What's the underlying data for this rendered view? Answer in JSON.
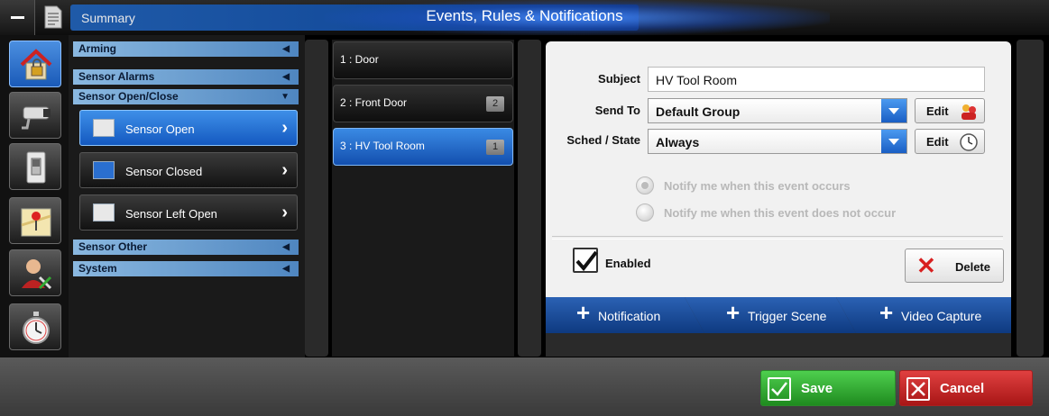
{
  "header": {
    "title": "Events, Rules & Notifications",
    "summary_tab": "Summary"
  },
  "rail": {
    "items": [
      {
        "icon": "house-lock-icon",
        "active": true
      },
      {
        "icon": "security-camera-icon",
        "active": false
      },
      {
        "icon": "light-switch-icon",
        "active": false
      },
      {
        "icon": "map-pin-icon",
        "active": false
      },
      {
        "icon": "user-tools-icon",
        "active": false
      },
      {
        "icon": "stopwatch-icon",
        "active": false
      }
    ]
  },
  "categories": {
    "arming": "Arming",
    "sensor_alarms": "Sensor Alarms",
    "sensor_open_close": "Sensor Open/Close",
    "sensor_other": "Sensor Other",
    "system": "System",
    "subitems": [
      {
        "label": "Sensor Open",
        "active": true
      },
      {
        "label": "Sensor Closed",
        "active": false
      },
      {
        "label": "Sensor Left Open",
        "active": false
      }
    ]
  },
  "events": [
    {
      "label": "1 : Door",
      "badge": ""
    },
    {
      "label": "2 : Front Door",
      "badge": "2"
    },
    {
      "label": "3 : HV Tool Room",
      "badge": "1"
    }
  ],
  "detail": {
    "subject_label": "Subject",
    "subject_value": "HV Tool Room",
    "send_to_label": "Send To",
    "send_to_value": "Default Group",
    "sched_label": "Sched / State",
    "sched_value": "Always",
    "edit_label": "Edit",
    "radio_occurs": "Notify me when this event occurs",
    "radio_not_occurs": "Notify me when this event does not occur",
    "enabled_label": "Enabled",
    "enabled_checked": true,
    "delete_label": "Delete"
  },
  "tabs": {
    "notification": "Notification",
    "trigger_scene": "Trigger Scene",
    "video_capture": "Video Capture"
  },
  "footer": {
    "save": "Save",
    "cancel": "Cancel"
  },
  "colors": {
    "accent_blue": "#1f5aa8",
    "save_green": "#2f9f2f",
    "cancel_red": "#c42020"
  }
}
